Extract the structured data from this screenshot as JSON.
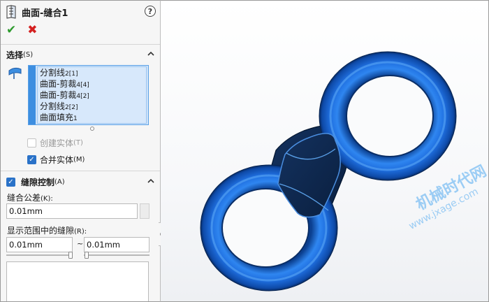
{
  "panel": {
    "title": "曲面-缝合1",
    "help_label": "?",
    "ok_glyph": "✔",
    "cancel_glyph": "✖"
  },
  "selection": {
    "title": "选择",
    "hotkey": "(S)",
    "items": [
      {
        "name": "分割线",
        "suffix": "2[1]"
      },
      {
        "name": "曲面-剪裁",
        "suffix": "4[4]"
      },
      {
        "name": "曲面-剪裁",
        "suffix": "4[2]"
      },
      {
        "name": "分割线",
        "suffix": "2[2]"
      },
      {
        "name": "曲面填充",
        "suffix": "1"
      }
    ],
    "create_solid": {
      "label": "创建实体",
      "hotkey": "(T)",
      "checked": false,
      "enabled": false
    },
    "merge_entities": {
      "label": "合并实体",
      "hotkey": "(M)",
      "checked": true,
      "enabled": true
    }
  },
  "gap_control": {
    "title": "缝隙控制",
    "hotkey": "(A)",
    "checked": true,
    "tolerance_label": "缝合公差",
    "tolerance_hotkey": "(K):",
    "tolerance_value": "0.01mm",
    "range_label": "显示范围中的缝隙",
    "range_hotkey": "(R):",
    "range_min": "0.01mm",
    "range_sep": "~",
    "range_max": "0.01mm"
  },
  "viewport": {
    "watermark": "机械时代网",
    "watermark_url": "www.jxage.com"
  },
  "colors": {
    "accent": "#2a72c8",
    "model_blue": "#1f6fe0",
    "model_dark": "#0e2a55",
    "ok_green": "#2e9b2e",
    "cancel_red": "#d42020"
  }
}
